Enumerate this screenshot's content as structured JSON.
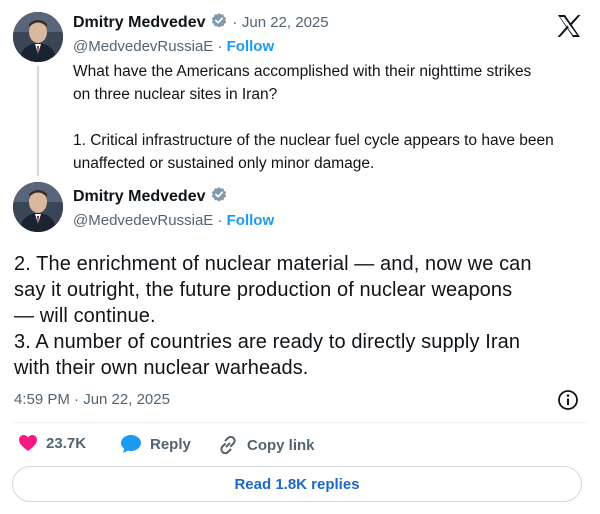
{
  "tweet1": {
    "author_name": "Dmitry Medvedev",
    "handle": "@MedvedevRussiaE",
    "separator": "·",
    "date": "Jun 22, 2025",
    "follow_label": "Follow",
    "text": "What have the Americans accomplished with their nighttime strikes\non three nuclear sites in Iran?\n\n1. Critical infrastructure of the nuclear fuel cycle appears to have been\nunaffected or sustained only minor damage."
  },
  "tweet2": {
    "author_name": "Dmitry Medvedev",
    "handle": "@MedvedevRussiaE",
    "separator": "·",
    "follow_label": "Follow",
    "text": "2. The enrichment of nuclear material — and, now we can\nsay it outright, the future production of nuclear weapons\n— will continue.\n3. A number of countries are ready to directly supply Iran\nwith their own nuclear warheads.",
    "timestamp": "4:59 PM · Jun 22, 2025"
  },
  "actions": {
    "likes_count": "23.7K",
    "reply_label": "Reply",
    "copy_link_label": "Copy link",
    "read_replies_label": "Read 1.8K replies"
  },
  "colors": {
    "accent": "#1d9bf0",
    "heart": "#f91880",
    "verified": "#829aab"
  },
  "icons": [
    "x-logo-icon",
    "verified-badge-icon",
    "info-icon",
    "heart-icon",
    "reply-bubble-icon",
    "link-icon"
  ]
}
